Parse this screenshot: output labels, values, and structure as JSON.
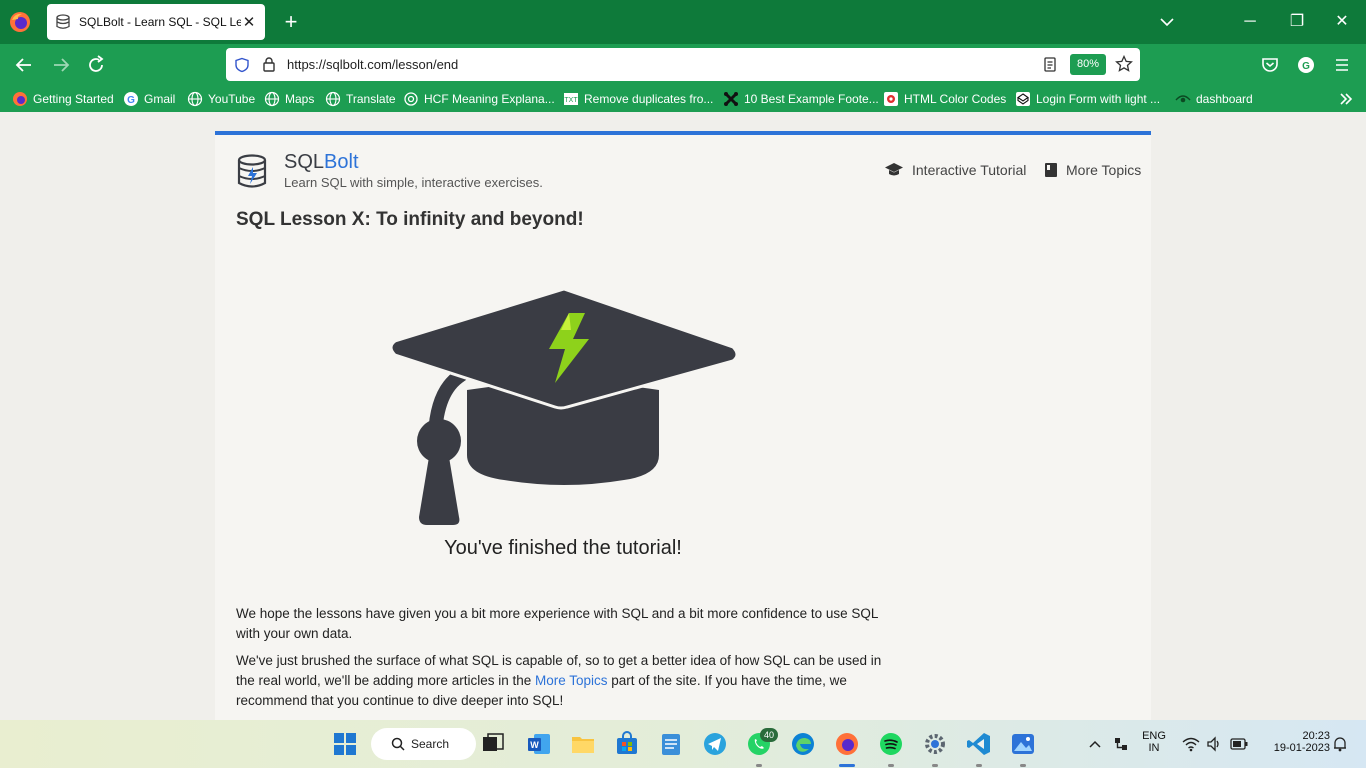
{
  "browser": {
    "tab_title": "SQLBolt - Learn SQL - SQL Lesson X: To infinity and beyond!",
    "url": "https://sqlbolt.com/lesson/end",
    "zoom": "80%",
    "accent": "#0e7a3a"
  },
  "bookmarks": [
    {
      "label": "Getting Started",
      "icon": "firefox-icon"
    },
    {
      "label": "Gmail",
      "icon": "google-icon"
    },
    {
      "label": "YouTube",
      "icon": "globe-icon"
    },
    {
      "label": "Maps",
      "icon": "globe-icon"
    },
    {
      "label": "Translate",
      "icon": "globe-icon"
    },
    {
      "label": "HCF Meaning Explana...",
      "icon": "openai-icon"
    },
    {
      "label": "Remove duplicates fro...",
      "icon": "txt-icon"
    },
    {
      "label": "10 Best Example Foote...",
      "icon": "joomla-icon"
    },
    {
      "label": "HTML Color Codes",
      "icon": "color-icon"
    },
    {
      "label": "Login Form with light ...",
      "icon": "codepen-icon"
    },
    {
      "label": "dashboard",
      "icon": "eye-icon"
    }
  ],
  "site": {
    "brand_prefix": "SQL",
    "brand_highlight": "Bolt",
    "tagline": "Learn SQL with simple, interactive exercises.",
    "nav": [
      "Interactive Tutorial",
      "More Topics"
    ],
    "accent": "#2d73d8"
  },
  "lesson": {
    "title": "SQL Lesson X: To infinity and beyond!",
    "finished": "You've finished the tutorial!",
    "para1": "We hope the lessons have given you a bit more experience with SQL and a bit more confidence to use SQL with your own data.",
    "para2_before": "We've just brushed the surface of what SQL is capable of, so to get a better idea of how SQL can be used in the real world, we'll be adding more articles in the ",
    "para2_link": "More Topics",
    "para2_after": " part of the site. If you have the time, we recommend that you continue to dive deeper into SQL!"
  },
  "taskbar": {
    "search_label": "Search",
    "whatsapp_badge": "40",
    "lang_top": "ENG",
    "lang_bottom": "IN",
    "time": "20:23",
    "date": "19-01-2023"
  }
}
